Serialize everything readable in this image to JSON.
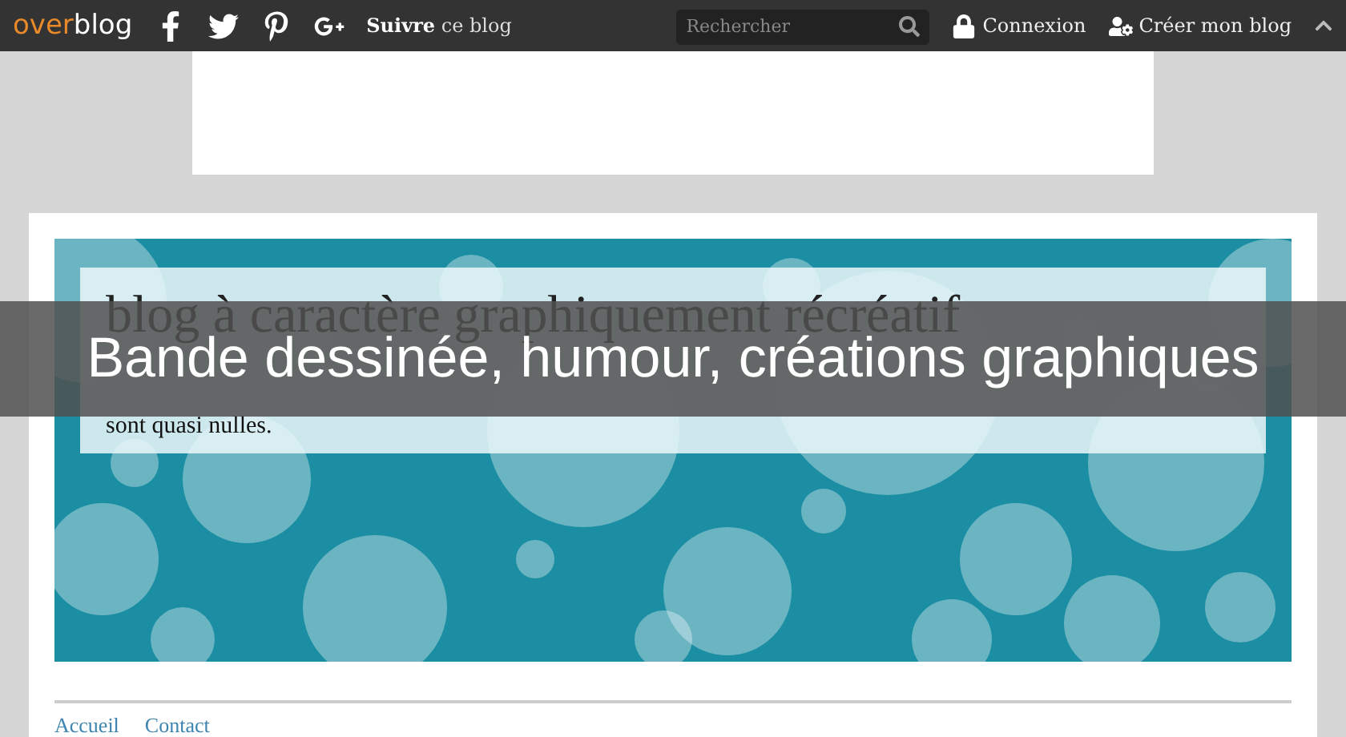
{
  "topbar": {
    "logo": {
      "part_1": "over",
      "part_2": "blog"
    },
    "follow": {
      "bold": "Suivre",
      "rest": "ce blog"
    },
    "search": {
      "placeholder": "Rechercher"
    },
    "links": [
      {
        "label": "Connexion",
        "kind": "lock"
      },
      {
        "label": "Créer mon blog",
        "kind": "user"
      }
    ]
  },
  "header": {
    "title": "blog à caractère graphiquement récréatif",
    "description": "sont quasi nulles."
  },
  "nav": [
    {
      "label": "Accueil"
    },
    {
      "label": "Contact"
    }
  ],
  "overlay": {
    "caption": "Bande dessinée, humour, créations graphiques"
  }
}
